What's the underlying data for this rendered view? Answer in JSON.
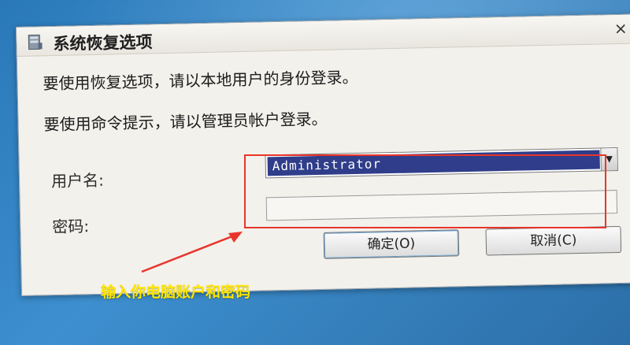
{
  "dialog": {
    "title": "系统恢复选项",
    "message_recovery": "要使用恢复选项，请以本地用户的身份登录。",
    "message_command": "要使用命令提示，请以管理员帐户登录。",
    "username_label": "用户名:",
    "password_label": "密码:",
    "username_value": "Administrator",
    "password_value": "",
    "ok_label": "确定(O)",
    "cancel_label": "取消(C)",
    "close_glyph": "×"
  },
  "annotation": {
    "hint": "输入你电脑账户和密码"
  },
  "colors": {
    "highlight": "#e8352b",
    "hint_text": "#ffe600",
    "selection": "#2f3d8a"
  },
  "icons": {
    "title_icon": "system-recovery-icon",
    "dropdown": "chevron-down-icon",
    "close": "close-icon"
  }
}
